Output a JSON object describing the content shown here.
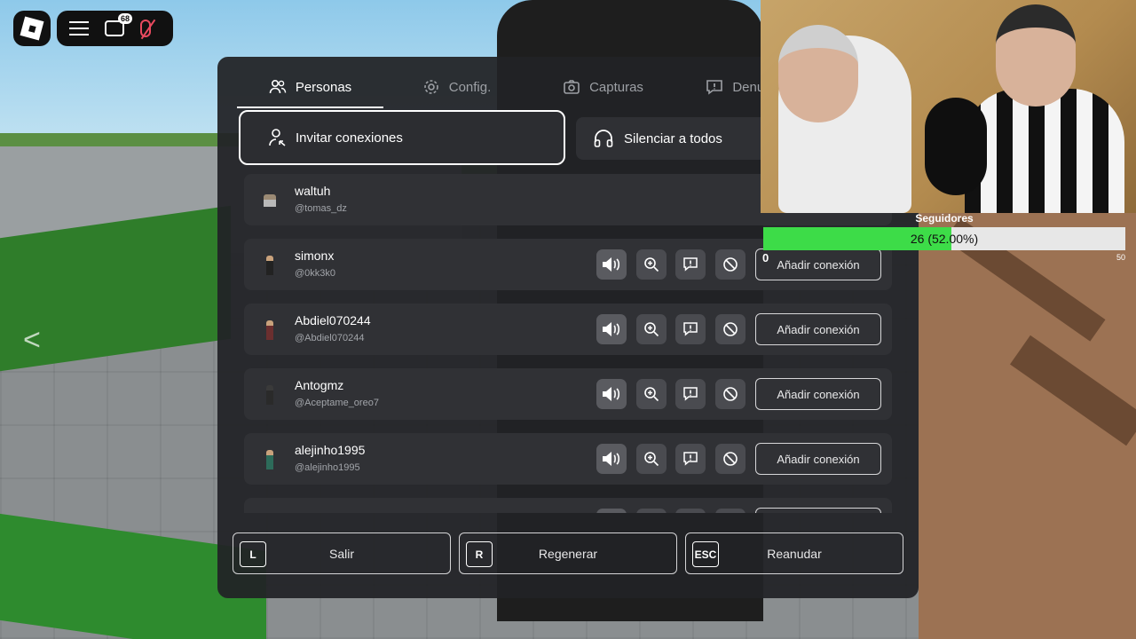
{
  "topbar": {
    "chat_badge": "68"
  },
  "tabs": [
    {
      "label": "Personas",
      "icon": "people-icon",
      "active": true
    },
    {
      "label": "Config.",
      "icon": "gear-icon",
      "active": false
    },
    {
      "label": "Capturas",
      "icon": "camera-icon",
      "active": false
    },
    {
      "label": "Denunciar",
      "icon": "report-icon",
      "active": false
    }
  ],
  "actions": {
    "invite_label": "Invitar conexiones",
    "mute_all_label": "Silenciar a todos"
  },
  "players": [
    {
      "name": "waltuh",
      "handle": "@tomas_dz",
      "is_self": true
    },
    {
      "name": "simonx",
      "handle": "@0kk3k0",
      "add_label": "Añadir conexión"
    },
    {
      "name": "Abdiel070244",
      "handle": "@Abdiel070244",
      "add_label": "Añadir conexión"
    },
    {
      "name": "Antogmz",
      "handle": "@Aceptame_oreo7",
      "add_label": "Añadir conexión"
    },
    {
      "name": "alejinho1995",
      "handle": "@alejinho1995",
      "add_label": "Añadir conexión"
    }
  ],
  "bottom": [
    {
      "key": "L",
      "label": "Salir"
    },
    {
      "key": "R",
      "label": "Regenerar"
    },
    {
      "key": "ESC",
      "label": "Reanudar"
    }
  ],
  "followers": {
    "title": "Seguidores",
    "progress_text": "26 (52.00%)",
    "current": 26,
    "goal": 50,
    "fraction": 0.52,
    "min_label": "0",
    "max_label": "50",
    "bar_color": "#3ddc48"
  }
}
